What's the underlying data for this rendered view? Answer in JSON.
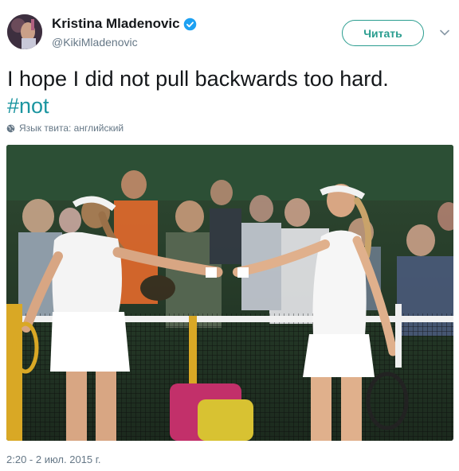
{
  "user": {
    "name": "Kristina Mladenovic",
    "handle": "@KikiMladenovic",
    "verified": true
  },
  "actions": {
    "follow_label": "Читать"
  },
  "tweet": {
    "text": "I hope I did not pull backwards too hard.",
    "hashtag": "#not",
    "language_note": "Язык твита: английский",
    "timestamp": "2:20 - 2 июл. 2015 г."
  },
  "media": {
    "photo_description_icon": "tennis-photo"
  },
  "colors": {
    "accent": "#2a9d8f",
    "hashtag": "#1b95a0",
    "verified": "#1da1f2",
    "muted": "#657786",
    "text": "#14171a"
  }
}
